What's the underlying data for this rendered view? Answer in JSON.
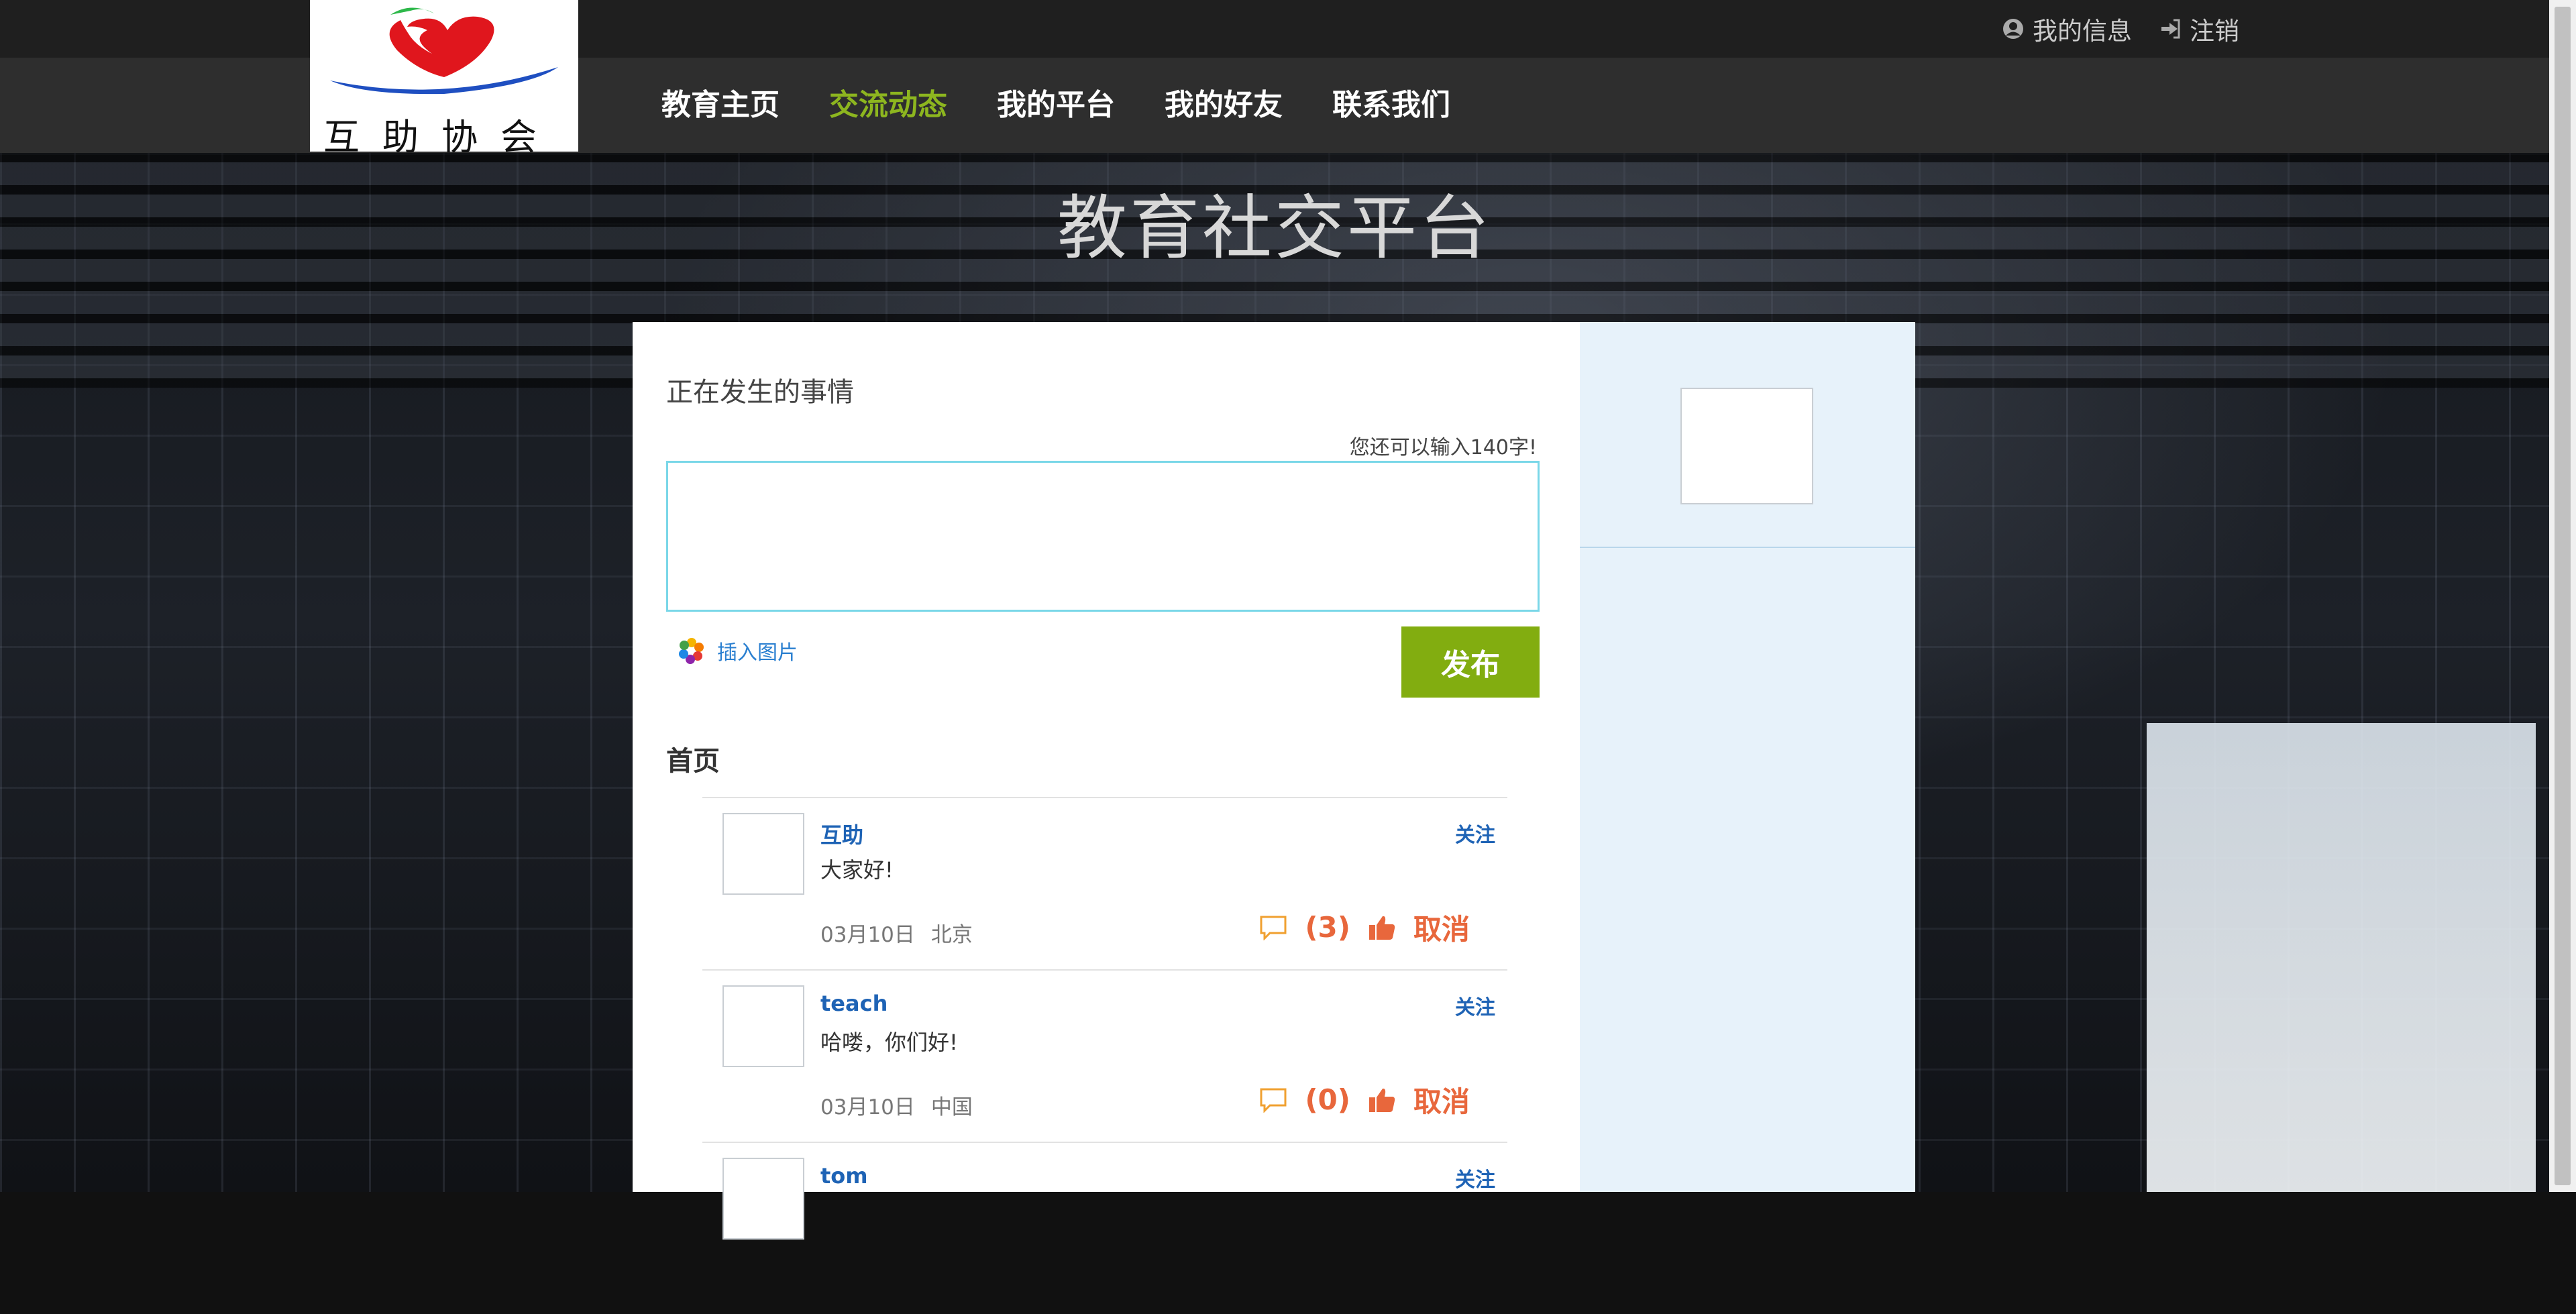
{
  "logo": {
    "text": "互助协会"
  },
  "header": {
    "my_info": "我的信息",
    "logout": "注销",
    "nav": [
      {
        "label": "教育主页",
        "active": false
      },
      {
        "label": "交流动态",
        "active": true
      },
      {
        "label": "我的平台",
        "active": false
      },
      {
        "label": "我的好友",
        "active": false
      },
      {
        "label": "联系我们",
        "active": false
      }
    ]
  },
  "hero": {
    "title": "教育社交平台"
  },
  "composer": {
    "heading": "正在发生的事情",
    "remaining": "您还可以输入140字!",
    "insert_image": "插入图片",
    "publish": "发布"
  },
  "feed": {
    "section_title": "首页",
    "follow_label": "关注",
    "cancel_label": "取消",
    "posts": [
      {
        "name": "互助",
        "text": "大家好!",
        "date": "03月10日",
        "location": "北京",
        "comments": "(3)"
      },
      {
        "name": "teach",
        "text": "哈喽，你们好!",
        "date": "03月10日",
        "location": "中国",
        "comments": "(0)"
      },
      {
        "name": "tom",
        "text": "",
        "date": "",
        "location": "",
        "comments": ""
      }
    ]
  },
  "colors": {
    "accent_green": "#82ad10",
    "nav_active": "#8db61f",
    "link_blue": "#1e63b5",
    "action_orange": "#e8673c"
  }
}
